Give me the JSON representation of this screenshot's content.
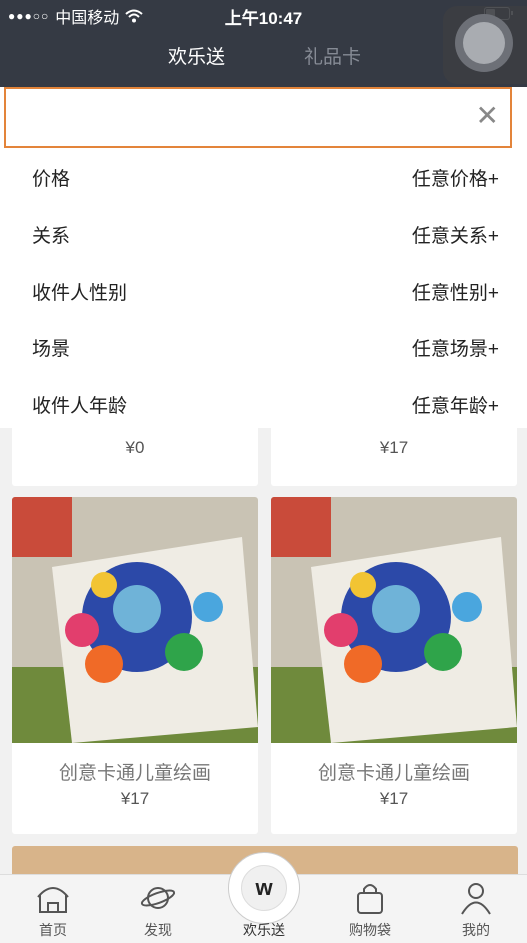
{
  "status_bar": {
    "carrier": "中国移动",
    "time": "上午10:47"
  },
  "header": {
    "tabs": [
      {
        "label": "欢乐送",
        "active": true
      },
      {
        "label": "礼品卡",
        "active": false
      }
    ]
  },
  "search": {
    "value": "",
    "placeholder": "",
    "clear_icon": "close-icon"
  },
  "filters": [
    {
      "label": "价格",
      "value": "任意价格+"
    },
    {
      "label": "关系",
      "value": "任意关系+"
    },
    {
      "label": "收件人性别",
      "value": "任意性别+"
    },
    {
      "label": "场景",
      "value": "任意场景+"
    },
    {
      "label": "收件人年龄",
      "value": "任意年龄+"
    }
  ],
  "products": [
    {
      "name": "",
      "price": "¥0"
    },
    {
      "name": "",
      "price": "¥17"
    },
    {
      "name": "创意卡通儿童绘画",
      "price": "¥17"
    },
    {
      "name": "创意卡通儿童绘画",
      "price": "¥17"
    }
  ],
  "bottom_nav": [
    {
      "label": "首页",
      "icon": "home-icon"
    },
    {
      "label": "发现",
      "icon": "planet-icon"
    },
    {
      "label": "欢乐送",
      "icon": "w-logo-icon",
      "center": true
    },
    {
      "label": "购物袋",
      "icon": "bag-icon"
    },
    {
      "label": "我的",
      "icon": "user-icon"
    }
  ],
  "colors": {
    "header_bg": "#353a44",
    "search_border": "#e3843a",
    "inactive_tab": "#868b95"
  }
}
